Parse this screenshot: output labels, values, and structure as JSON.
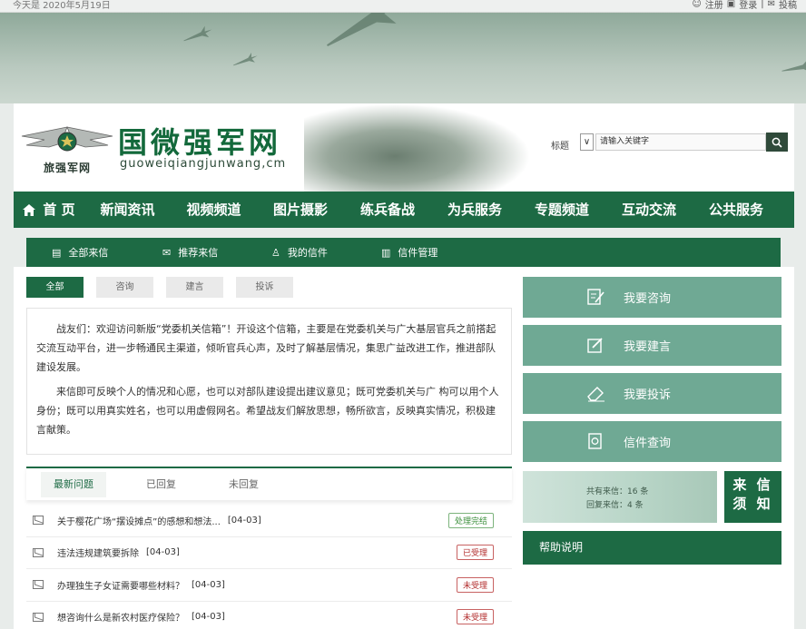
{
  "topbar": {
    "date": "今天是 2020年5月19日",
    "register": "注册",
    "login": "登录",
    "divider": "|",
    "submit": "投稿"
  },
  "header": {
    "site_name": "国微强军网",
    "site_url": "guoweiqiangjunwang,cm",
    "emblem_sub": "旅强军网",
    "search_label": "标题",
    "search_select": "∨",
    "search_placeholder": "请输入关键字"
  },
  "nav": {
    "items": [
      "首 页",
      "新闻资讯",
      "视频频道",
      "图片摄影",
      "练兵备战",
      "为兵服务",
      "专题频道",
      "互动交流",
      "公共服务"
    ]
  },
  "subnav": {
    "items": [
      "全部来信",
      "推荐来信",
      "我的信件",
      "信件管理"
    ]
  },
  "tabs": [
    "全部",
    "咨询",
    "建言",
    "投诉"
  ],
  "intro": {
    "p1": "战友们：欢迎访问新版“党委机关信箱”！开设这个信箱，主要是在党委机关与广大基层官兵之前搭起交流互动平台，进一步畅通民主渠道，倾听官兵心声，及时了解基层情况，集思广益改进工作，推进部队建设发展。",
    "p2": "来信即可反映个人的情况和心愿，也可以对部队建设提出建议意见；既可党委机关与广 构可以用个人身份；既可以用真实姓名，也可以用虚假网名。希望战友们解放思想，畅所欲言，反映真实情况，积极建言献策。"
  },
  "question_tabs": [
    "最新问题",
    "已回复",
    "未回复"
  ],
  "questions": [
    {
      "title": "关于樱花广场“摆设摊点”的感想和想法...",
      "date": "[04-03]",
      "status": "处理完结"
    },
    {
      "title": "违法违规建筑要拆除",
      "date": "[04-03]",
      "status": "已受理"
    },
    {
      "title": "办理独生子女证需要哪些材料？",
      "date": "[04-03]",
      "status": "未受理"
    },
    {
      "title": "想咨询什么是新农村医疗保险？",
      "date": "[04-03]",
      "status": "未受理"
    }
  ],
  "side": {
    "buttons": [
      "我要咨询",
      "我要建言",
      "我要投诉",
      "信件查询"
    ],
    "total": "共有来信：16 条",
    "replied": "回复来信：4 条",
    "notice_l1": "来 信",
    "notice_l2": "须 知",
    "help": "帮助说明"
  },
  "colors": {
    "primary": "#1d6a44",
    "side_button": "#6fa994",
    "done": "#3b8f3b",
    "accepted": "#b22c2c"
  }
}
